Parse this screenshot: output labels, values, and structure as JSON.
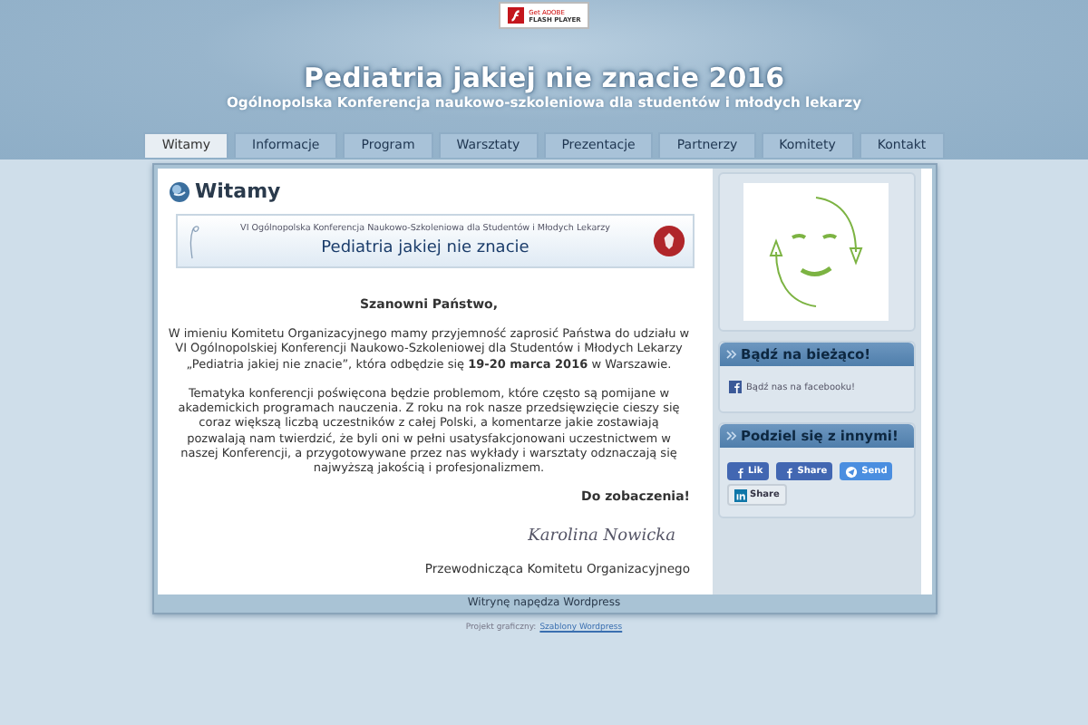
{
  "header": {
    "badge_line1": "Get ADOBE",
    "badge_line2": "FLASH PLAYER",
    "title": "Pediatria jakiej nie znacie 2016",
    "subtitle": "Ogólnopolska Konferencja naukowo-szkoleniowa dla studentów i młodych lekarzy"
  },
  "nav": [
    {
      "label": "Witamy",
      "selected": true
    },
    {
      "label": "Informacje",
      "selected": false
    },
    {
      "label": "Program",
      "selected": false
    },
    {
      "label": "Warsztaty",
      "selected": false
    },
    {
      "label": "Prezentacje",
      "selected": false
    },
    {
      "label": "Partnerzy",
      "selected": false
    },
    {
      "label": "Komitety",
      "selected": false
    },
    {
      "label": "Kontakt",
      "selected": false
    }
  ],
  "main": {
    "heading": "Witamy",
    "banner": {
      "line": "VI Ogólnopolska Konferencja Naukowo-Szkoleniowa dla Studentów i Młodych Lekarzy",
      "title": "Pediatria jakiej nie znacie"
    },
    "greeting": "Szanowni Państwo,",
    "paragraphs": [
      "W imieniu Komitetu Organizacyjnego mamy przyjemność zaprosić Państwa do udziału w VI Ogólnopolskiej Konferencji Naukowo-Szkoleniowej dla Studentów i Młodych Lekarzy „Pediatria jakiej nie znacie”, która odbędzie się **19-20 marca 2016** w Warszawie.",
      "Tematyka konferencji poświęcona będzie problemom, które często są pomijane w akademickich programach nauczenia. Z roku na rok nasze przedsięwzięcie cieszy się coraz większą liczbą uczestników z całej Polski, a komentarze jakie zostawiają pozwalają nam twierdzić, że byli oni w pełni usatysfakcjonowani uczestnictwem w naszej Konferencji, a przygotowywane przez nas wykłady i warsztaty odznaczają się najwyższą jakością i profesjonalizmem."
    ],
    "closing": "Do zobaczenia!",
    "signature": "Karolina Nowicka",
    "signer": "Przewodnicząca Komitetu Organizacyjnego"
  },
  "sidebar": {
    "follow": {
      "title": "Bądź na bieżąco!",
      "link": "Bądź nas na facebooku!"
    },
    "share": {
      "title": "Podziel się z innymi!",
      "buttons": [
        {
          "kind": "facebook",
          "label": "Lik"
        },
        {
          "kind": "facebook",
          "label": "Share"
        },
        {
          "kind": "send",
          "label": "Send"
        },
        {
          "kind": "linkedin",
          "label": "Share"
        }
      ]
    }
  },
  "footer": {
    "powered": "Witrynę napędza Wordpress"
  },
  "credits": {
    "prefix": "Projekt graficzny:",
    "link": "Szablony Wordpress"
  }
}
